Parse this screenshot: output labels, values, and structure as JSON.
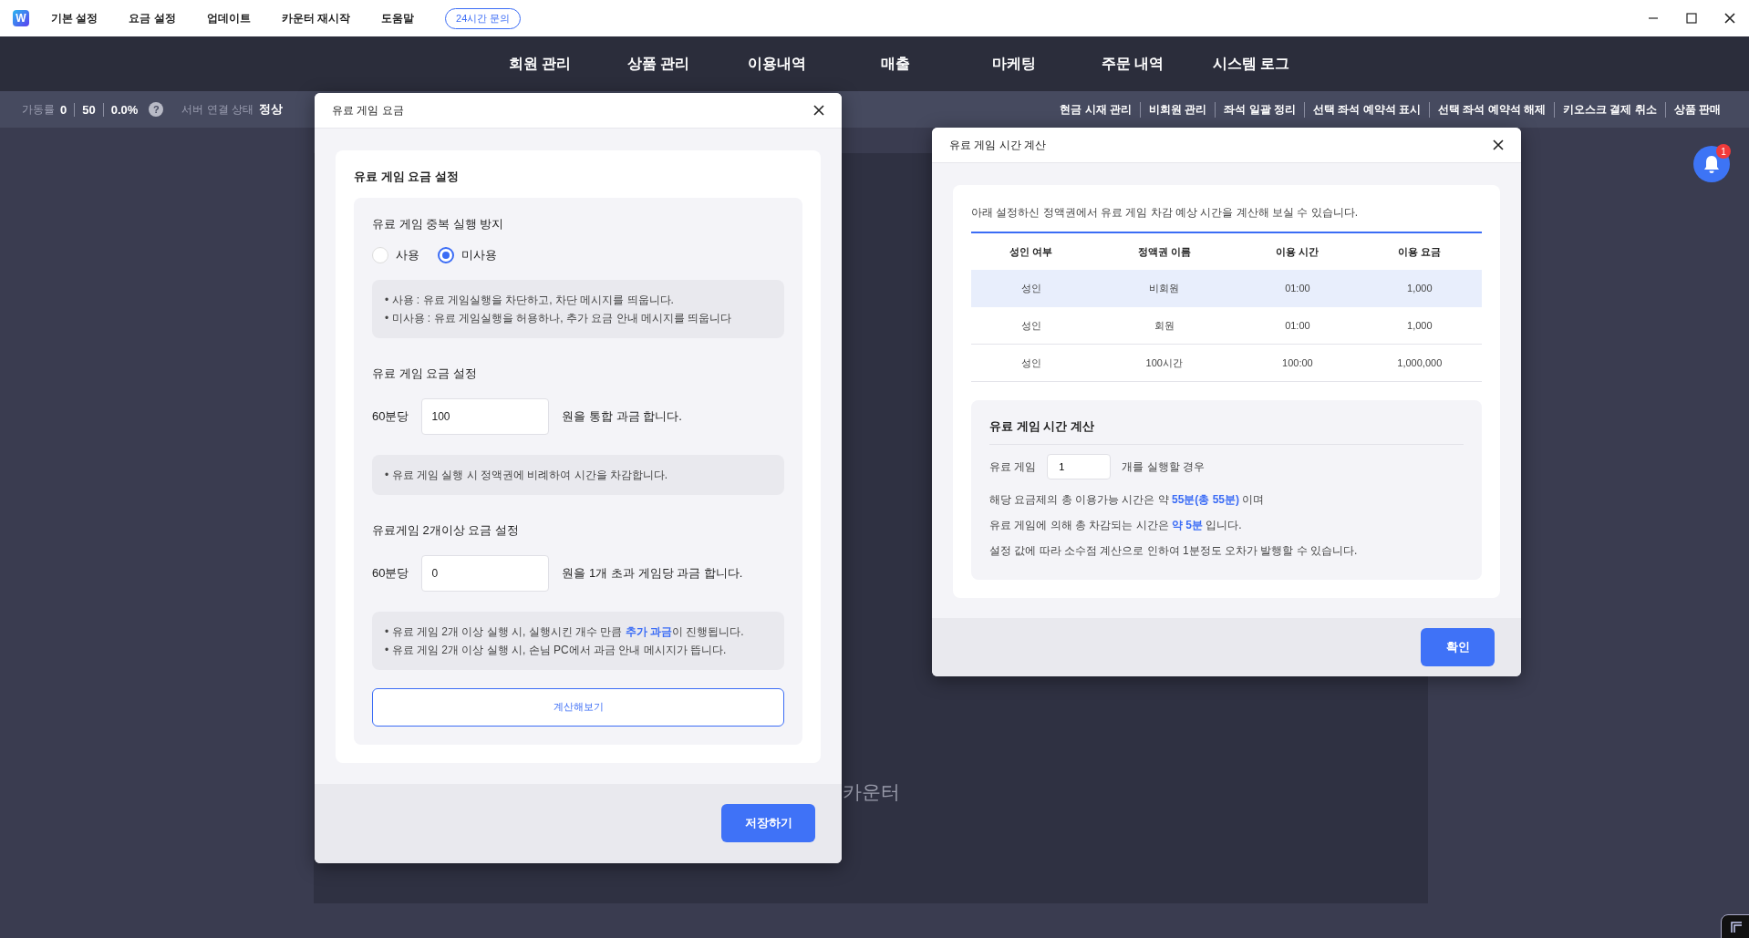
{
  "menu_bar": {
    "logo": "W",
    "items": [
      "기본 설정",
      "요금 설정",
      "업데이트",
      "카운터 재시작",
      "도움말"
    ],
    "support_badge": "24시간 문의"
  },
  "nav": {
    "items": [
      "회원 관리",
      "상품 관리",
      "이용내역",
      "매출",
      "마케팅",
      "주문 내역",
      "시스템 로그"
    ]
  },
  "status_bar": {
    "uptime_label": "가동률",
    "values": [
      "0",
      "50",
      "0.0%"
    ],
    "help": "?",
    "server_label": "서버 연결 상태",
    "server_status": "정상",
    "actions": [
      "현금 시재 관리",
      "비회원 관리",
      "좌석 일괄 정리",
      "선택 좌석 예약석 표시",
      "선택 좌석 예약석 해제",
      "키오스크 결제 취소",
      "상품 판매"
    ]
  },
  "background_panel": {
    "label": "카운터"
  },
  "notifications": {
    "count": "1"
  },
  "fee_dialog": {
    "title": "유료 게임 요금",
    "section_title": "유료 게임 요금 설정",
    "duplicate": {
      "title": "유료 게임 중복 실행 방지",
      "options": [
        {
          "label": "사용",
          "selected": false
        },
        {
          "label": "미사용",
          "selected": true
        }
      ],
      "notes": [
        "• 사용 : 유료 게임실행을 차단하고, 차단 메시지를 띄웁니다.",
        "• 미사용 : 유료 게임실행을 허용하나, 추가 요금 안내 메시지를 띄웁니다"
      ]
    },
    "rate": {
      "title": "유료 게임 요금 설정",
      "prefix": "60분당",
      "value": "100",
      "suffix": "원을 통합 과금 합니다.",
      "notes": [
        "• 유료 게임 실행 시 정액권에 비례하여 시간을 차감합니다."
      ]
    },
    "multi": {
      "title": "유료게임 2개이상 요금 설정",
      "prefix": "60분당",
      "value": "0",
      "suffix": "원을 1개 초과 게임당 과금 합니다.",
      "notes": [
        "• 유료 게임 2개 이상 실행 시, 실행시킨 개수 만큼 **추가 과금**이 진행됩니다.",
        "• 유료 게임 2개 이상 실행 시, 손님 PC에서 과금 안내 메시지가 뜹니다."
      ]
    },
    "calc_button": "계산해보기",
    "save_button": "저장하기"
  },
  "calc_dialog": {
    "title": "유료 게임 시간 계산",
    "intro": "아래 설정하신 정액권에서 유료 게임 차감 예상 시간을 계산해 보실 수 있습니다.",
    "table": {
      "columns": [
        "성인 여부",
        "정액권 이름",
        "이용 시간",
        "이용 요금"
      ],
      "rows": [
        {
          "cells": [
            "성인",
            "비회원",
            "01:00",
            "1,000"
          ],
          "selected": true
        },
        {
          "cells": [
            "성인",
            "회원",
            "01:00",
            "1,000"
          ],
          "selected": false
        },
        {
          "cells": [
            "성인",
            "100시간",
            "100:00",
            "1,000,000"
          ],
          "selected": false
        }
      ]
    },
    "calc": {
      "title": "유료 게임 시간 계산",
      "prefix": "유료 게임",
      "value": "1",
      "suffix": "개를 실행할 경우",
      "lines": [
        "해당 요금제의 총 이용가능 시간은 약 **55분(총 55분)** 이며",
        "유료 게임에 의해 총 차감되는 시간은 **약 5분** 입니다.",
        "설정 값에 따라 소수점 계산으로 인하여 1분정도 오차가 발행할 수 있습니다."
      ]
    },
    "confirm_button": "확인"
  }
}
